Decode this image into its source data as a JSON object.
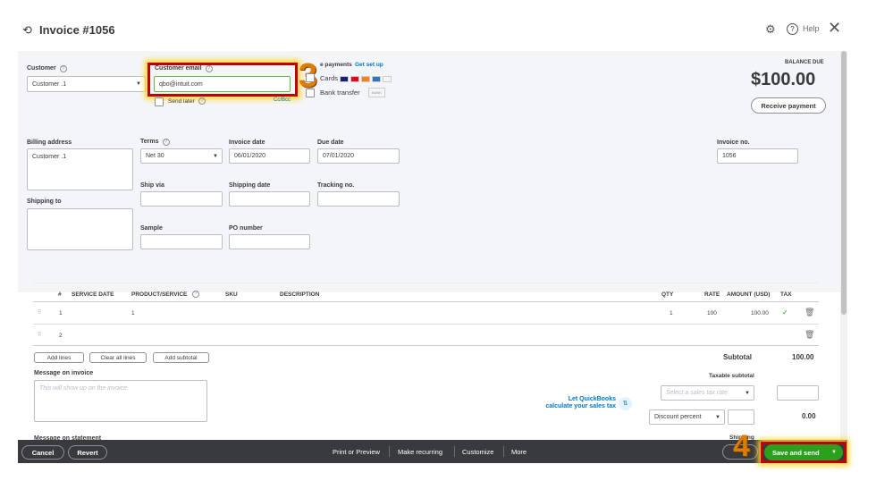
{
  "header": {
    "title": "Invoice #1056",
    "help": "Help"
  },
  "customer": {
    "label": "Customer",
    "value": "Customer .1"
  },
  "email": {
    "label": "Customer email",
    "value": "qbo@intuit.com",
    "send_later": "Send later",
    "cc_bcc": "Cc/Bcc"
  },
  "payments": {
    "label": "e payments",
    "setup": "Get set up",
    "cards": "Cards",
    "bank": "Bank transfer",
    "bank_badge": "BANK"
  },
  "balance": {
    "label": "BALANCE DUE",
    "amount": "$100.00",
    "receive": "Receive payment"
  },
  "billing": {
    "label": "Billing address",
    "value": "Customer .1",
    "shipping_label": "Shipping to"
  },
  "terms": {
    "label": "Terms",
    "value": "Net 30"
  },
  "invoice_date": {
    "label": "Invoice date",
    "value": "06/01/2020"
  },
  "due_date": {
    "label": "Due date",
    "value": "07/01/2020"
  },
  "invoice_no": {
    "label": "Invoice no.",
    "value": "1056"
  },
  "ship_via": "Ship via",
  "shipping_date": "Shipping date",
  "tracking": "Tracking no.",
  "sample": "Sample",
  "po": "PO number",
  "table": {
    "headers": [
      "#",
      "SERVICE DATE",
      "PRODUCT/SERVICE",
      "SKU",
      "DESCRIPTION",
      "QTY",
      "RATE",
      "AMOUNT (USD)",
      "TAX"
    ],
    "rows": [
      {
        "n": "1",
        "product": "1",
        "qty": "1",
        "rate": "100",
        "amount": "100.00"
      },
      {
        "n": "2"
      }
    ]
  },
  "buttons": {
    "add_lines": "Add lines",
    "clear": "Clear all lines",
    "add_subtotal": "Add subtotal"
  },
  "message": {
    "label": "Message on invoice",
    "placeholder": "This will show up on the invoice.",
    "statement": "Message on statement"
  },
  "totals": {
    "subtotal_label": "Subtotal",
    "subtotal": "100.00",
    "taxable": "Taxable subtotal",
    "tax_placeholder": "Select a sales tax rate",
    "discount": "Discount percent",
    "discount_value": "0.00",
    "shipping": "Shipping"
  },
  "qb_tax": {
    "line1": "Let QuickBooks",
    "line2": "calculate your sales tax"
  },
  "footer": {
    "cancel": "Cancel",
    "revert": "Revert",
    "print": "Print or Preview",
    "recurring": "Make recurring",
    "customize": "Customize",
    "more": "More",
    "save": "Save and send"
  },
  "steps": {
    "s3": "3",
    "s4": "4"
  }
}
